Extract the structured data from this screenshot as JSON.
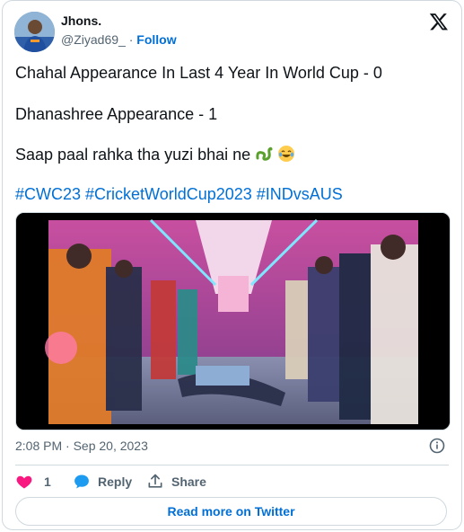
{
  "author": {
    "name": "Jhons.",
    "handle": "@Ziyad69_",
    "separator": "·",
    "follow_label": "Follow"
  },
  "tweet": {
    "lines": [
      "Chahal Appearance In Last 4 Year In World Cup - 0",
      "Dhanashree Appearance - 1",
      "Saap paal rahka tha yuzi bhai ne"
    ],
    "hashtags": "#CWC23 #CricketWorldCup2023 #INDvsAUS"
  },
  "timestamp": "2:08 PM · Sep 20, 2023",
  "actions": {
    "like_count": "1",
    "reply_label": "Reply",
    "share_label": "Share"
  },
  "read_more_label": "Read more on Twitter",
  "colors": {
    "accent": "#006fd6",
    "like": "#f91880",
    "reply": "#1d9bf0",
    "muted": "#536471"
  },
  "icons": [
    "x-logo-icon",
    "info-icon",
    "heart-icon",
    "reply-bubble-icon",
    "share-icon",
    "snake-emoji-icon",
    "laughing-emoji-icon"
  ]
}
